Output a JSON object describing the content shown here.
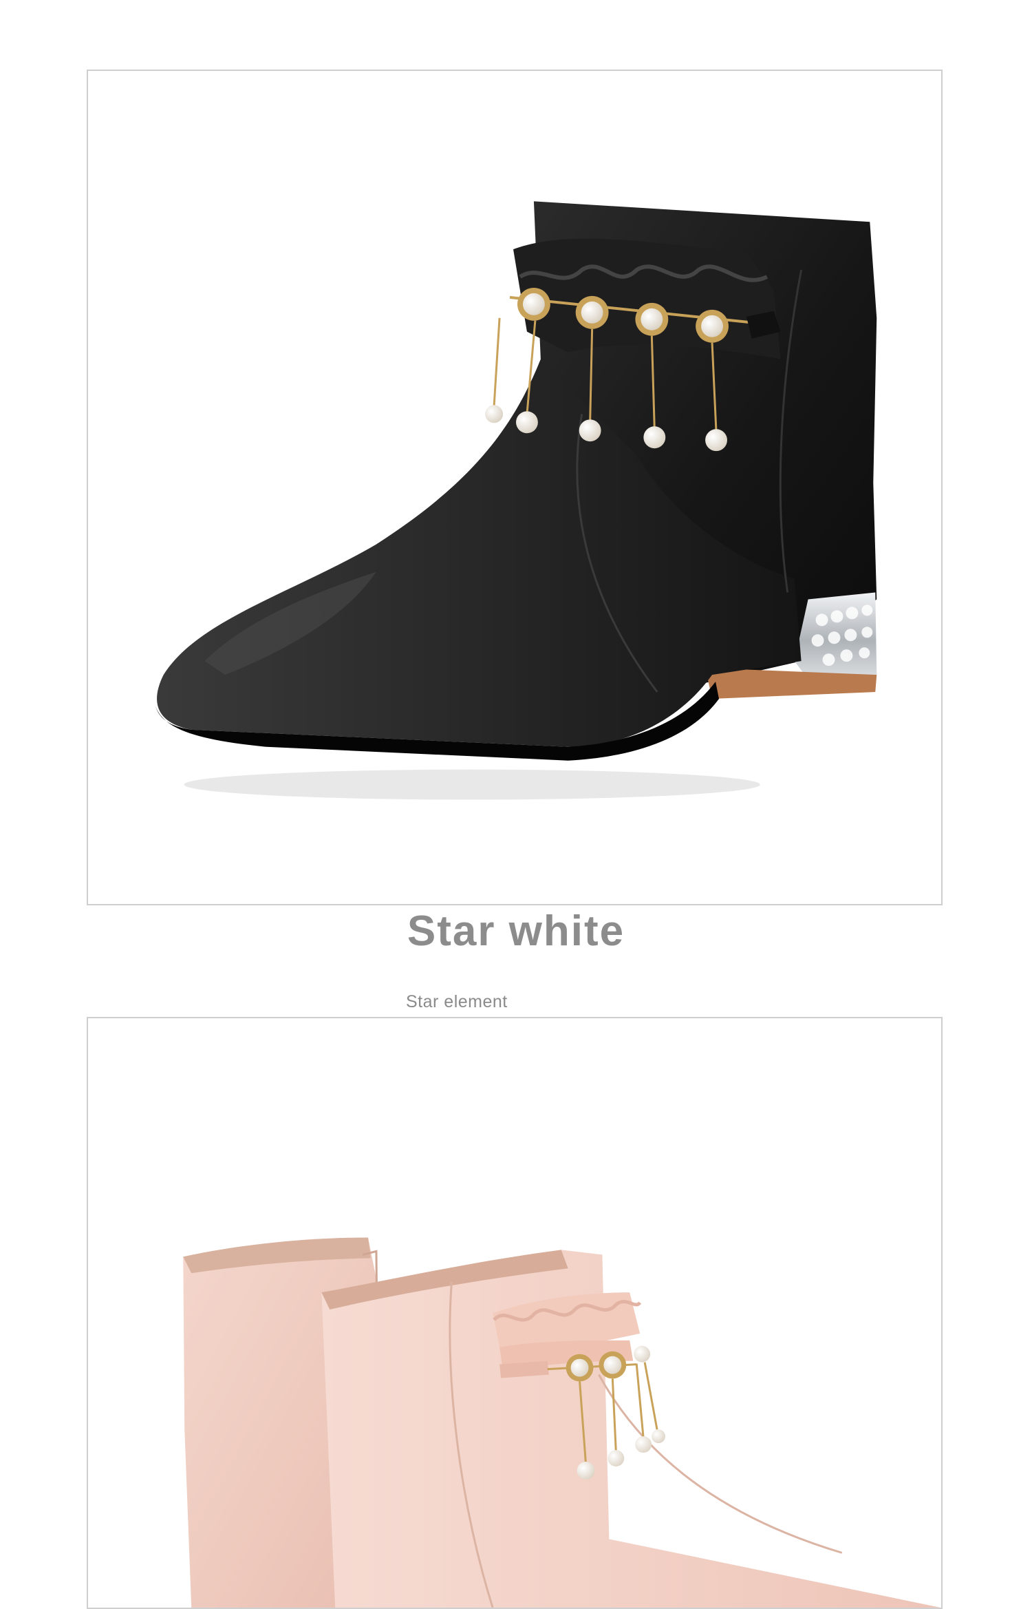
{
  "product": {
    "color_title": "Star white",
    "subtitle": "Star element"
  },
  "images": [
    {
      "name": "black-ankle-boot-photo",
      "icon": "boot-photo-black"
    },
    {
      "name": "pink-ankle-boot-photo",
      "icon": "boot-photo-pink"
    }
  ],
  "colors": {
    "frame_border": "#cfcfcf",
    "title_gray": "#8c8c8c",
    "subtitle_gray": "#8a8a8a",
    "boot_black": "#1c1c1c",
    "boot_pink": "#efc9bd",
    "pearl": "#f4efe6",
    "gold_chain": "#c9a25a",
    "heel_silver": "#cfd3d6",
    "sole_tan": "#b97a4e"
  }
}
